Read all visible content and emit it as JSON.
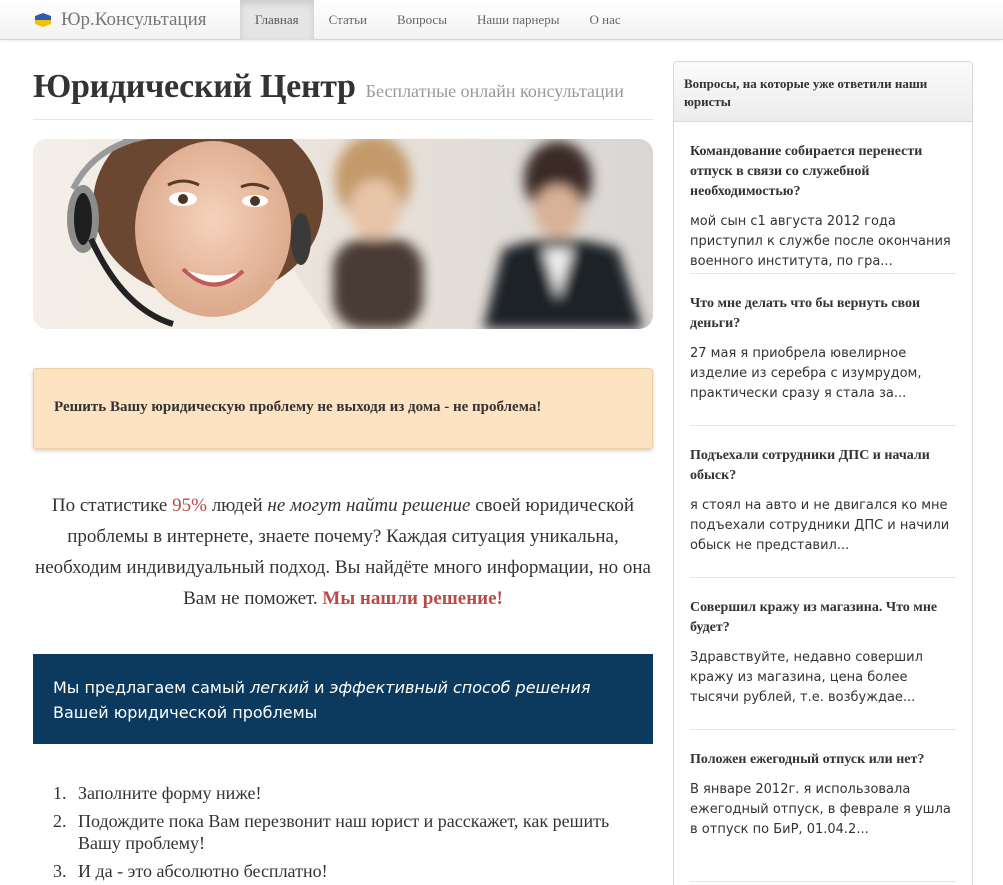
{
  "brand": {
    "name": "Юр.Консультация",
    "icon": "ukraine-flag-icon"
  },
  "nav": [
    {
      "label": "Главная",
      "active": true
    },
    {
      "label": "Статьи",
      "active": false
    },
    {
      "label": "Вопросы",
      "active": false
    },
    {
      "label": "Наши парнеры",
      "active": false
    },
    {
      "label": "О нас",
      "active": false
    }
  ],
  "header": {
    "title": "Юридический Центр",
    "subtitle": "Бесплатные онлайн консультации"
  },
  "callout": "Решить Вашу юридическую проблему не выходя из дома - не проблема!",
  "stats": {
    "p1": "По статистике ",
    "percent": "95%",
    "p2": " людей ",
    "em": "не могут найти решение",
    "p3": " своей юридической проблемы в интернете, знаете почему? Каждая ситуация уникальна, необходим индивидуальный подход. Вы найдёте много информации, но она Вам не поможет. ",
    "strong": "Мы нашли решение!"
  },
  "offer": {
    "p1": "Мы предлагаем самый ",
    "em1": "легкий",
    "p2": " и ",
    "em2": "эффективный способ решения",
    "p3": " Вашей юридической проблемы"
  },
  "steps": [
    {
      "num": "1.",
      "text": "Заполните форму ниже!"
    },
    {
      "num": "2.",
      "text": "Подождите пока Вам перезвонит наш юрист и расскажет, как решить Вашу проблему!"
    },
    {
      "num": "3.",
      "text": "И да - это абсолютно бесплатно!"
    }
  ],
  "sidebar": {
    "heading": "Вопросы, на которые уже ответили наши юристы",
    "questions": [
      {
        "title": "Командование собирается перенести отпуск в связи со служебной необходимостью?",
        "excerpt": "мой сын с1 августа 2012 года приступил к службе после окончания военного института, по гра..."
      },
      {
        "title": "Что мне делать что бы вернуть свои деньги?",
        "excerpt": "27 мая я приобрела ювелирное изделие из серебра с изумрудом, практически сразу я стала за..."
      },
      {
        "title": "Подъехали сотрудники ДПС и начали обыск?",
        "excerpt": "я стоял на авто и не двигался ко мне подъехали сотрудники ДПС и начили обыск не представил..."
      },
      {
        "title": "Совершил кражу из магазина. Что мне будет?",
        "excerpt": "Здравствуйте, недавно совершил кражу из магазина, цена более тысячи рублей, т.е. возбуждае..."
      },
      {
        "title": "Положен ежегодный отпуск или нет?",
        "excerpt": "В январе 2012г. я использовала ежегодный отпуск, в феврале я ушла в отпуск по БиР, 01.04.2..."
      }
    ]
  }
}
